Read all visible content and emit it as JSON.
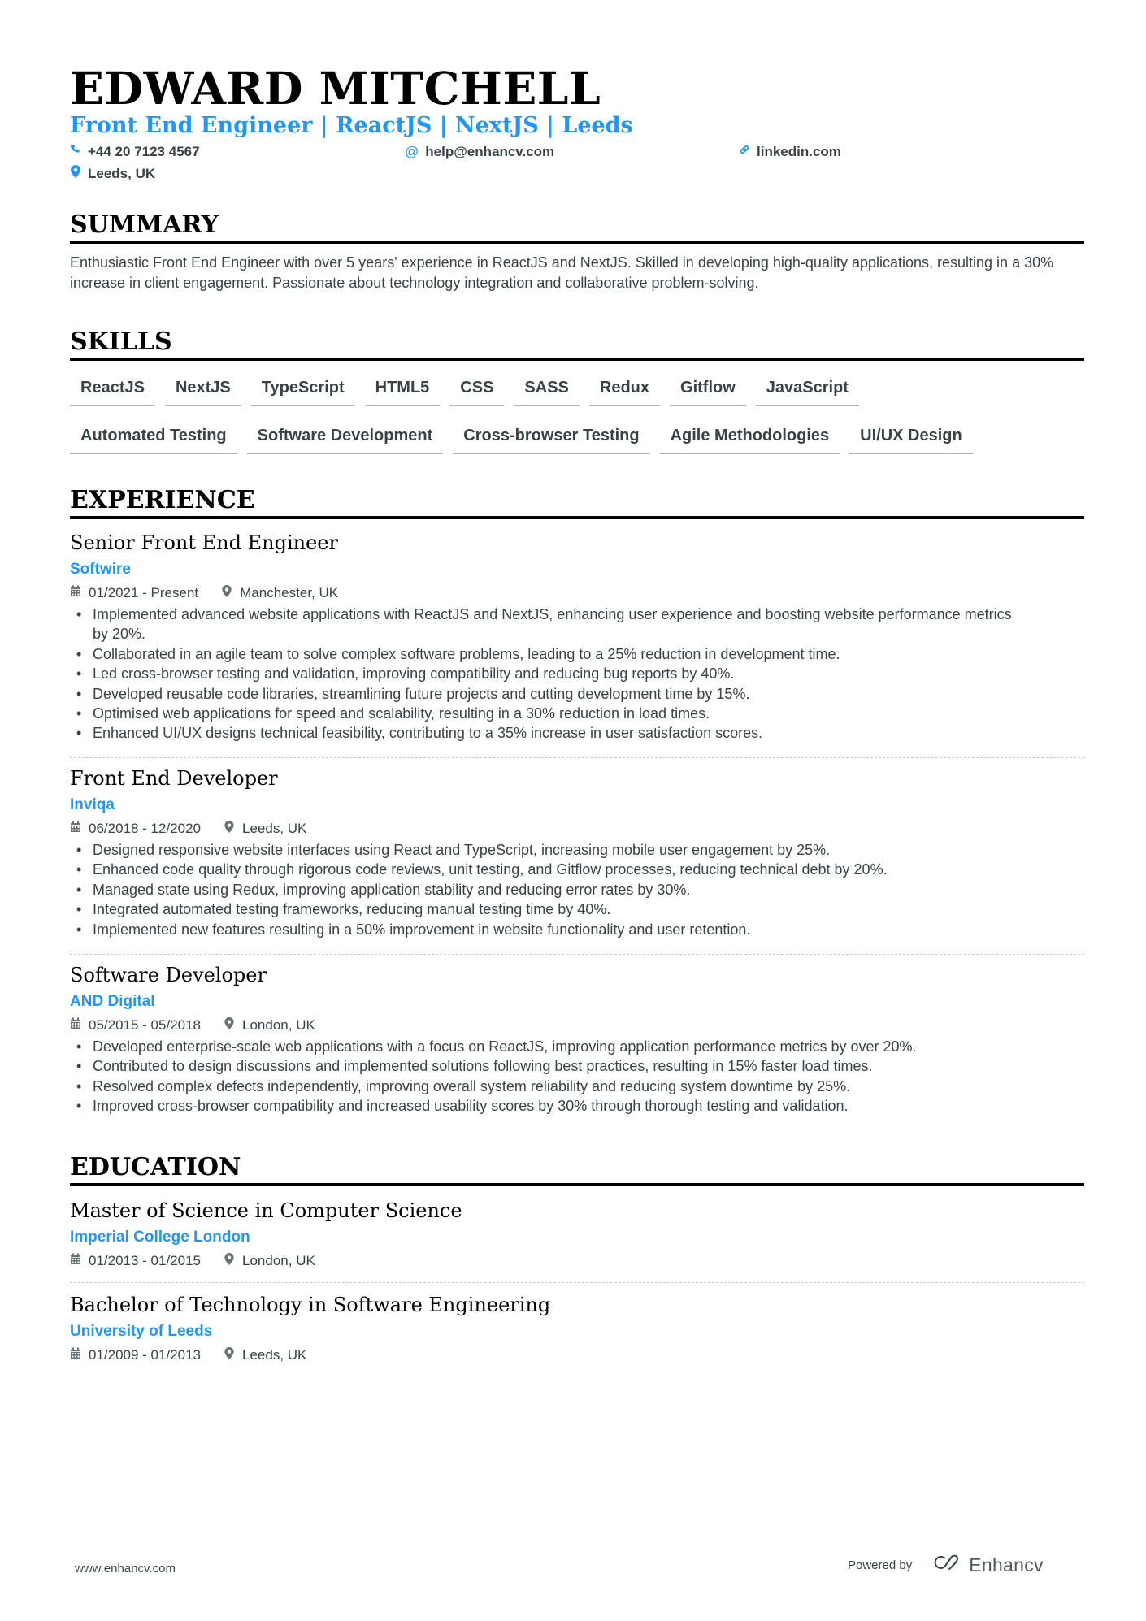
{
  "header": {
    "name": "EDWARD MITCHELL",
    "subtitle": "Front End Engineer | ReactJS | NextJS | Leeds",
    "contacts": [
      {
        "icon": "phone-icon",
        "text": "+44 20 7123 4567"
      },
      {
        "icon": "at-icon",
        "text": "help@enhancv.com"
      },
      {
        "icon": "link-icon",
        "text": "linkedin.com"
      },
      {
        "icon": "location-icon",
        "text": "Leeds, UK"
      }
    ]
  },
  "colors": {
    "accent": "#2196f3",
    "text": "#384347",
    "heading": "#000000"
  },
  "summary": {
    "title": "SUMMARY",
    "text": "Enthusiastic Front End Engineer with over 5 years' experience in ReactJS and NextJS. Skilled in developing high-quality applications, resulting in a 30% increase in client engagement. Passionate about technology integration and collaborative problem-solving."
  },
  "skills": {
    "title": "SKILLS",
    "row1": [
      "ReactJS",
      "NextJS",
      "TypeScript",
      "HTML5",
      "CSS",
      "SASS",
      "Redux",
      "Gitflow",
      "JavaScript"
    ],
    "row2": [
      "Automated Testing",
      "Software Development",
      "Cross-browser Testing",
      "Agile Methodologies",
      "UI/UX Design"
    ]
  },
  "experience": {
    "title": "EXPERIENCE",
    "items": [
      {
        "title": "Senior Front End Engineer",
        "company": "Softwire",
        "dates": "01/2021 - Present",
        "location": "Manchester, UK",
        "bullets": [
          "Implemented advanced website applications with ReactJS and NextJS, enhancing user experience and boosting website performance metrics by 20%.",
          "Collaborated in an agile team to solve complex software problems, leading to a 25% reduction in development time.",
          "Led cross-browser testing and validation, improving compatibility and reducing bug reports by 40%.",
          "Developed reusable code libraries, streamlining future projects and cutting development time by 15%.",
          "Optimised web applications for speed and scalability, resulting in a 30% reduction in load times.",
          "Enhanced UI/UX designs technical feasibility, contributing to a 35% increase in user satisfaction scores."
        ]
      },
      {
        "title": "Front End Developer",
        "company": "Inviqa",
        "dates": "06/2018 - 12/2020",
        "location": "Leeds, UK",
        "bullets": [
          "Designed responsive website interfaces using React and TypeScript, increasing mobile user engagement by 25%.",
          "Enhanced code quality through rigorous code reviews, unit testing, and Gitflow processes, reducing technical debt by 20%.",
          "Managed state using Redux, improving application stability and reducing error rates by 30%.",
          "Integrated automated testing frameworks, reducing manual testing time by 40%.",
          "Implemented new features resulting in a 50% improvement in website functionality and user retention."
        ]
      },
      {
        "title": "Software Developer",
        "company": "AND Digital",
        "dates": "05/2015 - 05/2018",
        "location": "London, UK",
        "bullets": [
          "Developed enterprise-scale web applications with a focus on ReactJS, improving application performance metrics by over 20%.",
          "Contributed to design discussions and implemented solutions following best practices, resulting in 15% faster load times.",
          "Resolved complex defects independently, improving overall system reliability and reducing system downtime by 25%.",
          "Improved cross-browser compatibility and increased usability scores by 30% through thorough testing and validation."
        ]
      }
    ]
  },
  "education": {
    "title": "EDUCATION",
    "items": [
      {
        "title": "Master of Science in Computer Science",
        "school": "Imperial College London",
        "dates": "01/2013 - 01/2015",
        "location": "London, UK"
      },
      {
        "title": "Bachelor of Technology in Software Engineering",
        "school": "University of Leeds",
        "dates": "01/2009 - 01/2013",
        "location": "Leeds, UK"
      }
    ]
  },
  "footer": {
    "website": "www.enhancv.com",
    "powered_by": "Powered by",
    "brand": "Enhancv"
  }
}
